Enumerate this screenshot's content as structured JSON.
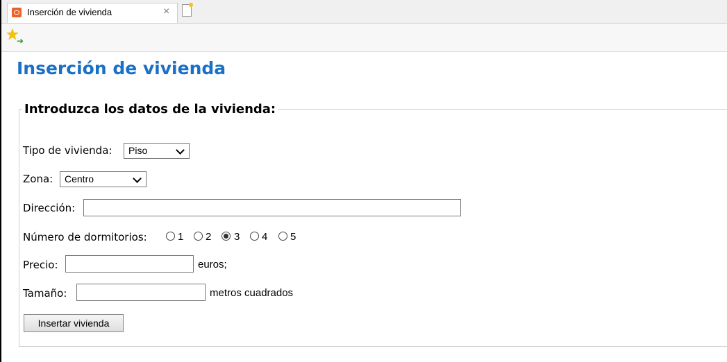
{
  "browser": {
    "tab_title": "Inserción de vivienda",
    "tab_close": "×"
  },
  "page": {
    "title": "Inserción de vivienda"
  },
  "form": {
    "legend": "Introduzca los datos de la vivienda:",
    "tipo": {
      "label": "Tipo de vivienda:",
      "selected": "Piso"
    },
    "zona": {
      "label": "Zona:",
      "selected": "Centro"
    },
    "direccion": {
      "label": "Dirección:",
      "value": ""
    },
    "dormitorios": {
      "label": "Número de dormitorios:",
      "options": [
        "1",
        "2",
        "3",
        "4",
        "5"
      ],
      "selected": "3"
    },
    "precio": {
      "label": "Precio:",
      "value": "",
      "suffix": "euros;"
    },
    "tamano": {
      "label": "Tamaño:",
      "value": "",
      "suffix": "metros cuadrados"
    },
    "submit_label": "Insertar vivienda"
  }
}
